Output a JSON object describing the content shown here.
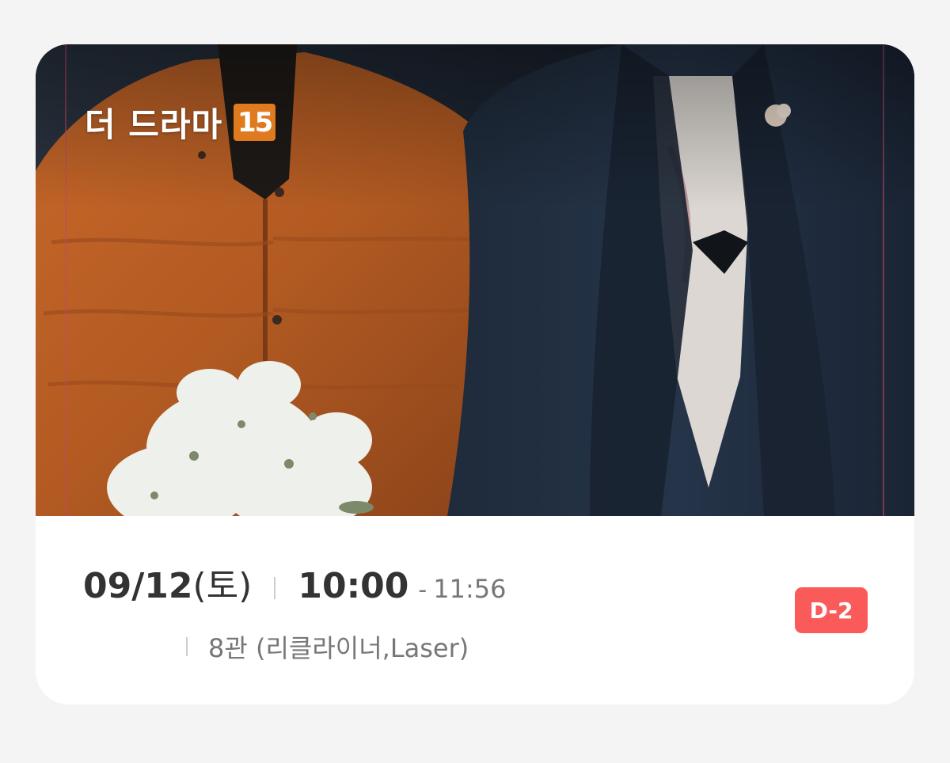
{
  "movie": {
    "title": "더 드라마",
    "rating": "15",
    "rating_color": "#e07a1f"
  },
  "schedule": {
    "date": "09/12",
    "day": "(토)",
    "start_time": "10:00",
    "dash": "-",
    "end_time": "11:56"
  },
  "theater": {
    "screen": "8관 (리클라이너,Laser)"
  },
  "badge": {
    "dday": "D-2",
    "color": "#fa5a5a"
  }
}
